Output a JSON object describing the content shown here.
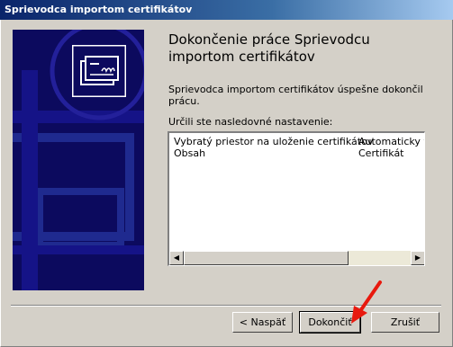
{
  "window": {
    "title": "Sprievodca importom certifikátov"
  },
  "main": {
    "heading_line1": "Dokončenie práce Sprievodcu",
    "heading_line2": "importom certifikátov",
    "success_text": "Sprievodca importom certifikátov úspešne dokončil prácu.",
    "settings_label": "Určili ste nasledovné nastavenie:"
  },
  "settings_list": [
    {
      "name": "Vybratý priestor na uloženie certifikátov",
      "value": "Automaticky vy"
    },
    {
      "name": "Obsah",
      "value": "Certifikát"
    }
  ],
  "buttons": {
    "back": "< Naspäť",
    "finish": "Dokončiť",
    "cancel": "Zrušiť"
  },
  "colors": {
    "banner": "#0c0a5e",
    "annotation_arrow": "#e8190e"
  },
  "icons": [
    "certificate-icon",
    "scroll-left-icon",
    "scroll-right-icon",
    "red-arrow-annotation"
  ]
}
